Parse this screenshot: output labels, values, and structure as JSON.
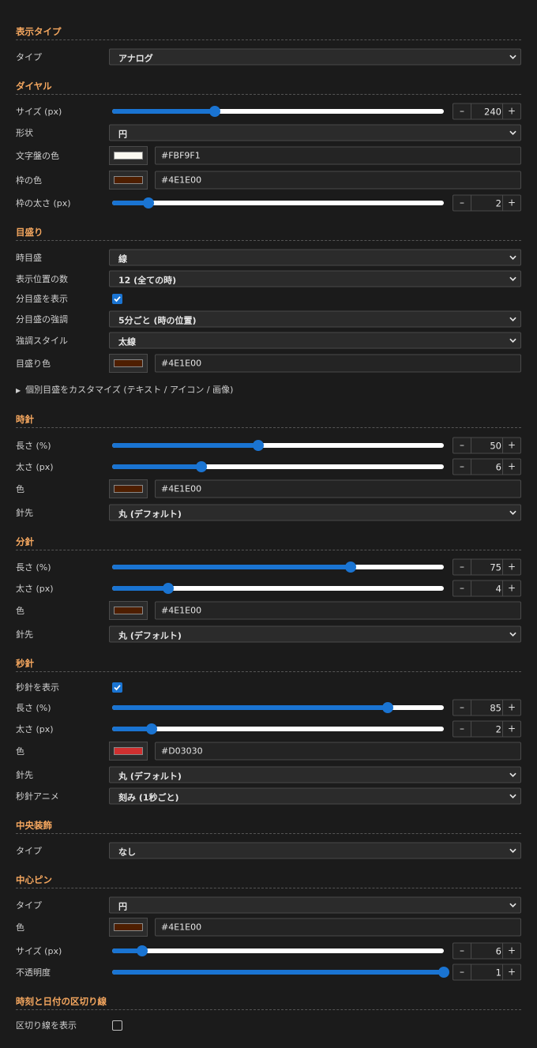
{
  "display_type": {
    "title": "表示タイプ",
    "type_label": "タイプ",
    "type_value": "アナログ"
  },
  "dial": {
    "title": "ダイヤル",
    "size_label": "サイズ (px)",
    "size_value": "240",
    "size_fraction": 0.31,
    "shape_label": "形状",
    "shape_value": "円",
    "face_color_label": "文字盤の色",
    "face_color": "#FBF9F1",
    "border_color_label": "枠の色",
    "border_color": "#4E1E00",
    "border_width_label": "枠の太さ (px)",
    "border_width_value": "2",
    "border_width_fraction": 0.11
  },
  "ticks": {
    "title": "目盛り",
    "hour_tick_label": "時目盛",
    "hour_tick_value": "線",
    "positions_label": "表示位置の数",
    "positions_value": "12 (全ての時)",
    "show_minute_label": "分目盛を表示",
    "show_minute_checked": true,
    "minute_emphasis_label": "分目盛の強調",
    "minute_emphasis_value": "5分ごと (時の位置)",
    "emphasis_style_label": "強調スタイル",
    "emphasis_style_value": "太線",
    "tick_color_label": "目盛り色",
    "tick_color": "#4E1E00",
    "customize_label": "個別目盛をカスタマイズ (テキスト / アイコン / 画像)"
  },
  "hour_hand": {
    "title": "時針",
    "length_label": "長さ (%)",
    "length_value": "50",
    "length_fraction": 0.44,
    "width_label": "太さ (px)",
    "width_value": "6",
    "width_fraction": 0.27,
    "color_label": "色",
    "color": "#4E1E00",
    "tip_label": "針先",
    "tip_value": "丸 (デフォルト)"
  },
  "minute_hand": {
    "title": "分針",
    "length_label": "長さ (%)",
    "length_value": "75",
    "length_fraction": 0.72,
    "width_label": "太さ (px)",
    "width_value": "4",
    "width_fraction": 0.17,
    "color_label": "色",
    "color": "#4E1E00",
    "tip_label": "針先",
    "tip_value": "丸 (デフォルト)"
  },
  "second_hand": {
    "title": "秒針",
    "show_label": "秒針を表示",
    "show_checked": true,
    "length_label": "長さ (%)",
    "length_value": "85",
    "length_fraction": 0.83,
    "width_label": "太さ (px)",
    "width_value": "2",
    "width_fraction": 0.12,
    "color_label": "色",
    "color": "#D03030",
    "tip_label": "針先",
    "tip_value": "丸 (デフォルト)",
    "anim_label": "秒針アニメ",
    "anim_value": "刻み (1秒ごと)"
  },
  "center_decoration": {
    "title": "中央装飾",
    "type_label": "タイプ",
    "type_value": "なし"
  },
  "center_pin": {
    "title": "中心ピン",
    "type_label": "タイプ",
    "type_value": "円",
    "color_label": "色",
    "color": "#4E1E00",
    "size_label": "サイズ (px)",
    "size_value": "6",
    "size_fraction": 0.09,
    "opacity_label": "不透明度",
    "opacity_value": "1",
    "opacity_fraction": 1.0
  },
  "separator": {
    "title": "時刻と日付の区切り線",
    "show_label": "区切り線を表示",
    "show_checked": false
  },
  "ui": {
    "accent": "#1a74d2",
    "section_title_color": "#f5a75f"
  }
}
